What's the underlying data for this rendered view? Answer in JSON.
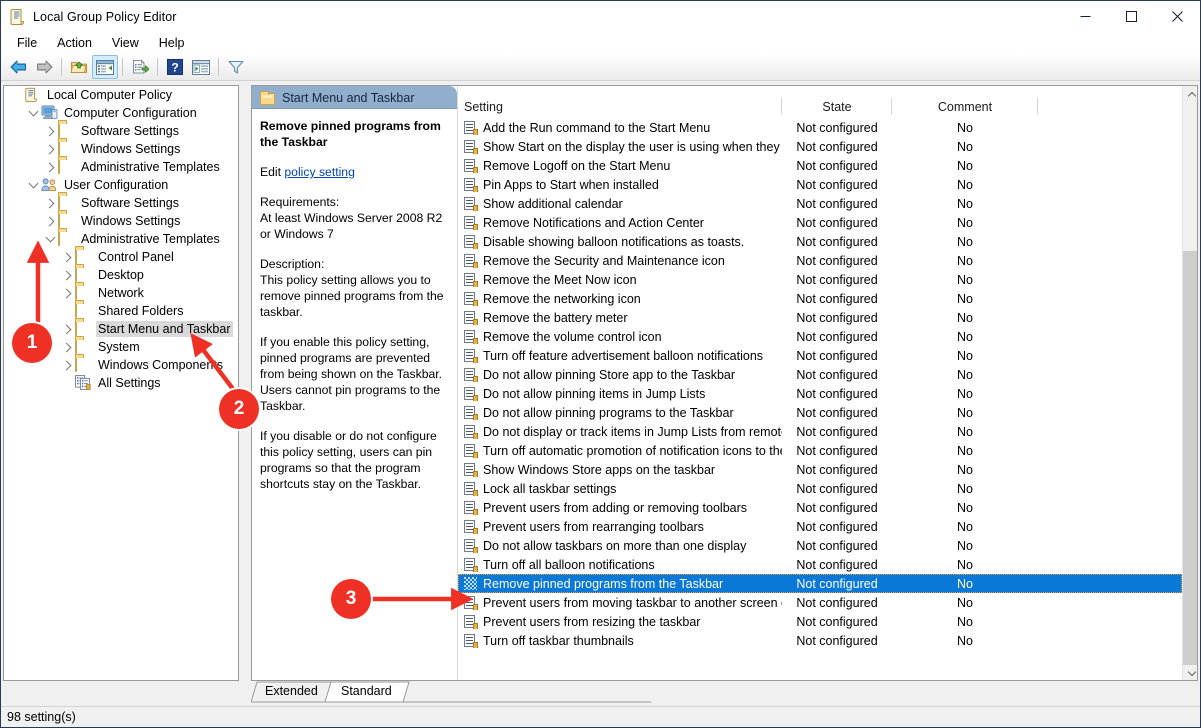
{
  "window": {
    "title": "Local Group Policy Editor",
    "icon": "policy-document-icon",
    "minimize": "—",
    "maximize": "☐",
    "close": "✕"
  },
  "menubar": {
    "items": [
      {
        "label": "File"
      },
      {
        "label": "Action"
      },
      {
        "label": "View"
      },
      {
        "label": "Help"
      }
    ]
  },
  "toolbar": {
    "buttons": [
      {
        "name": "back-button",
        "icon": "arrow-left-icon"
      },
      {
        "name": "forward-button",
        "icon": "arrow-right-icon"
      },
      {
        "name": "up-one-level-button",
        "icon": "folder-up-icon"
      },
      {
        "name": "show-hide-tree-button",
        "icon": "console-tree-icon"
      },
      {
        "name": "export-list-button",
        "icon": "export-list-icon"
      },
      {
        "name": "help-button",
        "icon": "question-mark-icon"
      },
      {
        "name": "properties-button",
        "icon": "properties-window-icon"
      },
      {
        "name": "filter-button",
        "icon": "funnel-filter-icon"
      }
    ]
  },
  "tree": {
    "items": [
      {
        "label": "Local Computer Policy",
        "depth": 0,
        "twisty": "none",
        "icon": "policy-document-icon"
      },
      {
        "label": "Computer Configuration",
        "depth": 1,
        "twisty": "down",
        "icon": "computer-icon"
      },
      {
        "label": "Software Settings",
        "depth": 2,
        "twisty": "right",
        "icon": "folder-icon"
      },
      {
        "label": "Windows Settings",
        "depth": 2,
        "twisty": "right",
        "icon": "folder-icon"
      },
      {
        "label": "Administrative Templates",
        "depth": 2,
        "twisty": "right",
        "icon": "folder-icon"
      },
      {
        "label": "User Configuration",
        "depth": 1,
        "twisty": "down",
        "icon": "users-icon"
      },
      {
        "label": "Software Settings",
        "depth": 2,
        "twisty": "right",
        "icon": "folder-icon"
      },
      {
        "label": "Windows Settings",
        "depth": 2,
        "twisty": "right",
        "icon": "folder-icon"
      },
      {
        "label": "Administrative Templates",
        "depth": 2,
        "twisty": "down",
        "icon": "folder-icon"
      },
      {
        "label": "Control Panel",
        "depth": 3,
        "twisty": "right",
        "icon": "folder-icon"
      },
      {
        "label": "Desktop",
        "depth": 3,
        "twisty": "right",
        "icon": "folder-icon"
      },
      {
        "label": "Network",
        "depth": 3,
        "twisty": "right",
        "icon": "folder-icon"
      },
      {
        "label": "Shared Folders",
        "depth": 3,
        "twisty": "none",
        "icon": "folder-icon"
      },
      {
        "label": "Start Menu and Taskbar",
        "depth": 3,
        "twisty": "right",
        "icon": "folder-icon",
        "selected": true
      },
      {
        "label": "System",
        "depth": 3,
        "twisty": "right",
        "icon": "folder-icon"
      },
      {
        "label": "Windows Components",
        "depth": 3,
        "twisty": "right",
        "icon": "folder-icon"
      },
      {
        "label": "All Settings",
        "depth": 3,
        "twisty": "none",
        "icon": "all-settings-icon"
      }
    ]
  },
  "pane_header": {
    "icon": "folder-icon",
    "title": "Start Menu and Taskbar"
  },
  "description": {
    "policy_title": "Remove pinned programs from the Taskbar",
    "edit_prefix": "Edit",
    "edit_link": "policy setting",
    "requirements_label": "Requirements:",
    "requirements_text": "At least Windows Server 2008 R2 or Windows 7",
    "description_label": "Description:",
    "paragraphs": [
      "This policy setting allows you to remove pinned programs from the taskbar.",
      "If you enable this policy setting, pinned programs are prevented from being shown on the Taskbar. Users cannot pin programs to the Taskbar.",
      "If you disable or do not configure this policy setting, users can pin programs so that the program shortcuts stay on the Taskbar."
    ]
  },
  "list": {
    "columns": [
      "Setting",
      "State",
      "Comment"
    ],
    "rows": [
      {
        "setting": "Add the Run command to the Start Menu",
        "state": "Not configured",
        "comment": "No"
      },
      {
        "setting": "Show Start on the display the user is using when they press t...",
        "state": "Not configured",
        "comment": "No"
      },
      {
        "setting": "Remove Logoff on the Start Menu",
        "state": "Not configured",
        "comment": "No"
      },
      {
        "setting": "Pin Apps to Start when installed",
        "state": "Not configured",
        "comment": "No"
      },
      {
        "setting": "Show additional calendar",
        "state": "Not configured",
        "comment": "No"
      },
      {
        "setting": "Remove Notifications and Action Center",
        "state": "Not configured",
        "comment": "No"
      },
      {
        "setting": "Disable showing balloon notifications as toasts.",
        "state": "Not configured",
        "comment": "No"
      },
      {
        "setting": "Remove the Security and Maintenance icon",
        "state": "Not configured",
        "comment": "No"
      },
      {
        "setting": "Remove the Meet Now icon",
        "state": "Not configured",
        "comment": "No"
      },
      {
        "setting": "Remove the networking icon",
        "state": "Not configured",
        "comment": "No"
      },
      {
        "setting": "Remove the battery meter",
        "state": "Not configured",
        "comment": "No"
      },
      {
        "setting": "Remove the volume control icon",
        "state": "Not configured",
        "comment": "No"
      },
      {
        "setting": "Turn off feature advertisement balloon notifications",
        "state": "Not configured",
        "comment": "No"
      },
      {
        "setting": "Do not allow pinning Store app to the Taskbar",
        "state": "Not configured",
        "comment": "No"
      },
      {
        "setting": "Do not allow pinning items in Jump Lists",
        "state": "Not configured",
        "comment": "No"
      },
      {
        "setting": "Do not allow pinning programs to the Taskbar",
        "state": "Not configured",
        "comment": "No"
      },
      {
        "setting": "Do not display or track items in Jump Lists from remote loca...",
        "state": "Not configured",
        "comment": "No"
      },
      {
        "setting": "Turn off automatic promotion of notification icons to the ta...",
        "state": "Not configured",
        "comment": "No"
      },
      {
        "setting": "Show Windows Store apps on the taskbar",
        "state": "Not configured",
        "comment": "No"
      },
      {
        "setting": "Lock all taskbar settings",
        "state": "Not configured",
        "comment": "No"
      },
      {
        "setting": "Prevent users from adding or removing toolbars",
        "state": "Not configured",
        "comment": "No"
      },
      {
        "setting": "Prevent users from rearranging toolbars",
        "state": "Not configured",
        "comment": "No"
      },
      {
        "setting": "Do not allow taskbars on more than one display",
        "state": "Not configured",
        "comment": "No"
      },
      {
        "setting": "Turn off all balloon notifications",
        "state": "Not configured",
        "comment": "No"
      },
      {
        "setting": "Remove pinned programs from the Taskbar",
        "state": "Not configured",
        "comment": "No",
        "selected": true
      },
      {
        "setting": "Prevent users from moving taskbar to another screen dock l...",
        "state": "Not configured",
        "comment": "No"
      },
      {
        "setting": "Prevent users from resizing the taskbar",
        "state": "Not configured",
        "comment": "No"
      },
      {
        "setting": "Turn off taskbar thumbnails",
        "state": "Not configured",
        "comment": "No"
      }
    ]
  },
  "tabs": [
    {
      "label": "Extended",
      "active": false
    },
    {
      "label": "Standard",
      "active": true
    }
  ],
  "statusbar": {
    "text": "98 setting(s)"
  },
  "annotations": {
    "accent_color": "#ee3124",
    "markers": [
      {
        "number": "1"
      },
      {
        "number": "2"
      },
      {
        "number": "3"
      }
    ]
  }
}
